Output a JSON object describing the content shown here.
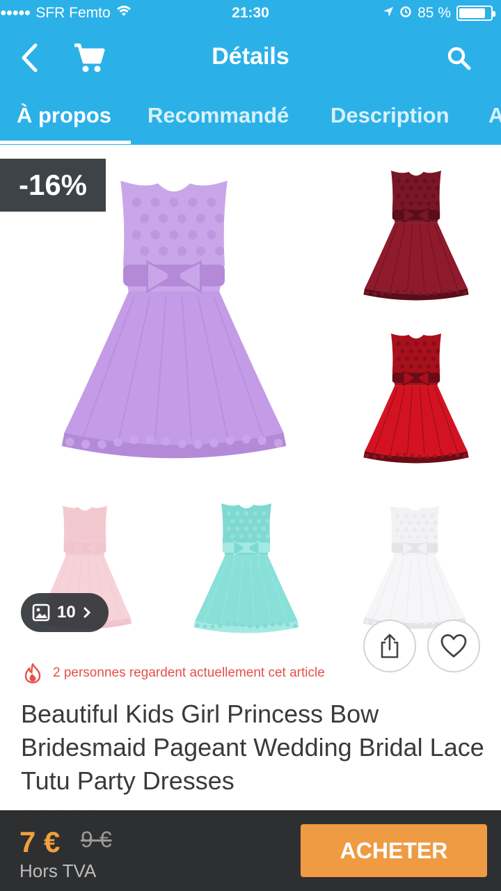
{
  "status_bar": {
    "signal": "●●●●●",
    "carrier": "SFR Femto",
    "time": "21:30",
    "battery_text": "85 %",
    "battery_level": 0.85
  },
  "navbar": {
    "title": "Détails",
    "back_icon": "chevron-left-icon",
    "cart_icon": "cart-icon",
    "search_icon": "search-icon"
  },
  "tabs": [
    {
      "label": "À propos",
      "active": true
    },
    {
      "label": "Recommandé",
      "active": false
    },
    {
      "label": "Description",
      "active": false
    },
    {
      "label": "A",
      "active": false
    }
  ],
  "gallery": {
    "discount": "-16%",
    "image_count": "10",
    "dresses": [
      {
        "name": "purple-dress",
        "top": "#c9a6e8",
        "skirt": "#c49be6",
        "trim": "#b48ad8"
      },
      {
        "name": "burgundy-dress",
        "top": "#7a1626",
        "skirt": "#8f1a2c",
        "trim": "#5b0d1a"
      },
      {
        "name": "red-dress",
        "top": "#a8101c",
        "skirt": "#d41322",
        "trim": "#6a0c16"
      },
      {
        "name": "pink-dress",
        "top": "#f3c9d0",
        "skirt": "#f6d3d9",
        "trim": "#f0c4cb"
      },
      {
        "name": "mint-dress",
        "top": "#7fd9d2",
        "skirt": "#88e0d8",
        "trim": "#a5e9e3"
      },
      {
        "name": "white-dress",
        "top": "#f2f2f4",
        "skirt": "#f6f6f8",
        "trim": "#e4e4e8"
      }
    ]
  },
  "info": {
    "watching": "2 personnes regardent actuellement cet article",
    "title": "Beautiful Kids Girl  Princess Bow Bridesmaid Pageant Wedding Bridal Lace Tutu Party Dresses"
  },
  "bottom_bar": {
    "price": "7 €",
    "old_price": "9 €",
    "tax_label": "Hors TVA",
    "buy_label": "ACHETER"
  },
  "colors": {
    "header": "#2bb1e8",
    "accent": "#ef9b43",
    "price": "#f0a03e",
    "bottom_bar": "#2e2f31"
  }
}
